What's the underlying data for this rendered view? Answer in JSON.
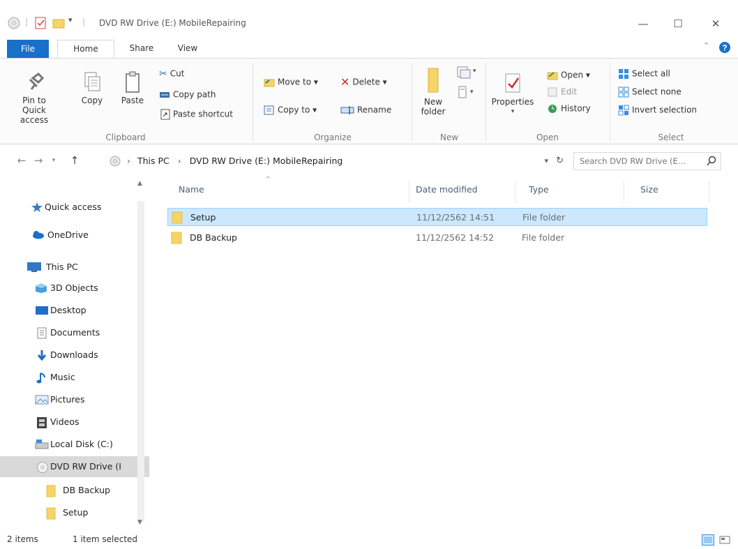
{
  "window": {
    "title": "DVD RW Drive (E:) MobileRepairing",
    "min_glyph": "—",
    "max_glyph": "☐",
    "close_glyph": "✕"
  },
  "ribbon_tabs": [
    "File",
    "Home",
    "Share",
    "View"
  ],
  "ribbon": {
    "clipboard": {
      "label": "Clipboard",
      "pin": "Pin to Quick access",
      "copy": "Copy",
      "paste": "Paste",
      "cut": "Cut",
      "copy_path": "Copy path",
      "paste_shortcut": "Paste shortcut"
    },
    "organize": {
      "label": "Organize",
      "move_to": "Move to ▾",
      "copy_to": "Copy to ▾",
      "delete": "Delete ▾",
      "rename": "Rename"
    },
    "new": {
      "label": "New",
      "new_folder": "New folder"
    },
    "open": {
      "label": "Open",
      "properties": "Properties",
      "open": "Open ▾",
      "edit": "Edit",
      "history": "History"
    },
    "select": {
      "label": "Select",
      "select_all": "Select all",
      "select_none": "Select none",
      "invert_selection": "Invert selection"
    }
  },
  "address": {
    "crumbs": [
      "This PC",
      "DVD RW Drive (E:) MobileRepairing"
    ],
    "separator": "›",
    "search_placeholder": "Search DVD RW Drive (E..."
  },
  "nav": {
    "items": [
      {
        "label": "Quick access",
        "icon": "star-icon"
      },
      {
        "label": "OneDrive",
        "icon": "cloud-icon"
      },
      {
        "label": "This PC",
        "icon": "computer-icon"
      },
      {
        "label": "3D Objects",
        "icon": "cube-icon"
      },
      {
        "label": "Desktop",
        "icon": "desktop-icon"
      },
      {
        "label": "Documents",
        "icon": "document-icon"
      },
      {
        "label": "Downloads",
        "icon": "download-arrow-icon"
      },
      {
        "label": "Music",
        "icon": "music-note-icon"
      },
      {
        "label": "Pictures",
        "icon": "pictures-icon"
      },
      {
        "label": "Videos",
        "icon": "film-icon"
      },
      {
        "label": "Local Disk (C:)",
        "icon": "drive-icon"
      },
      {
        "label": "DVD RW Drive (I",
        "icon": "disc-icon"
      },
      {
        "label": "DB Backup",
        "icon": "folder-icon"
      },
      {
        "label": "Setup",
        "icon": "folder-icon"
      }
    ]
  },
  "columns": {
    "name": "Name",
    "date_modified": "Date modified",
    "type": "Type",
    "size": "Size"
  },
  "files": [
    {
      "name": "Setup",
      "date": "11/12/2562 14:51",
      "type": "File folder",
      "selected": true
    },
    {
      "name": "DB Backup",
      "date": "11/12/2562 14:52",
      "type": "File folder",
      "selected": false
    }
  ],
  "status": {
    "count": "2 items",
    "selected": "1 item selected"
  },
  "colors": {
    "accent": "#1a6fc9",
    "selection_bg": "#cce8ff",
    "selection_border": "#99d1ff",
    "folder_yellow": "#f7d468"
  }
}
